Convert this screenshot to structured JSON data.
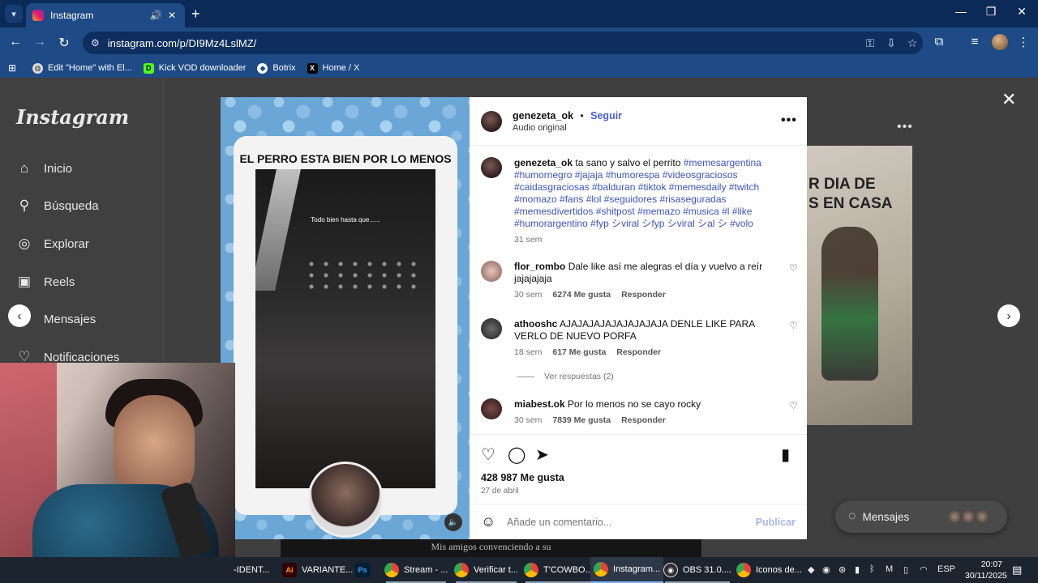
{
  "browser": {
    "tab": {
      "title": "Instagram"
    },
    "url": "instagram.com/p/DI9Mz4LslMZ/",
    "bookmarks": [
      {
        "label": "Edit \"Home\" with El...",
        "icon": "globe-icon"
      },
      {
        "label": "Kick VOD downloader",
        "icon": "kick-icon"
      },
      {
        "label": "Botrix",
        "icon": "botrix-icon"
      },
      {
        "label": "Home / X",
        "icon": "x-icon"
      }
    ]
  },
  "instagram": {
    "logo": "Instagram",
    "nav": [
      {
        "label": "Inicio",
        "icon": "home-icon"
      },
      {
        "label": "Búsqueda",
        "icon": "search-icon"
      },
      {
        "label": "Explorar",
        "icon": "explore-icon"
      },
      {
        "label": "Reels",
        "icon": "reels-icon"
      },
      {
        "label": "Mensajes",
        "icon": "messages-icon"
      },
      {
        "label": "Notificaciones",
        "icon": "heart-icon"
      }
    ],
    "background_post_caption_line1": "R DIA DE",
    "background_post_caption_line2": "S EN CASA",
    "messages_pill": "Mensajes"
  },
  "post": {
    "media": {
      "title": "EL PERRO ESTA BIEN POR LO MENOS",
      "video_caption": "Todo bien hasta que......",
      "subtitle": "Mis amigos convenciendo a su"
    },
    "author": "genezeta_ok",
    "follow_label": "Seguir",
    "separator": "•",
    "audio": "Audio original",
    "caption": {
      "username": "genezeta_ok",
      "text": "ta sano y salvo el perrito",
      "hashtags": "#memesargentina #humornegro #jajaja #humorespa #videosgraciosos #caidasgraciosas #balduran #tiktok #memesdaily #twitch #momazo #fans #lol #seguidores #risaseguradas #memesdivertidos #shitpost #memazo #musica #l #like #humorargentino #fyp シviral シfyp シviral シal シ #volo",
      "time": "31 sem"
    },
    "comments": [
      {
        "username": "flor_rombo",
        "text": "Dale like así me alegras el día y vuelvo a reír jajajajaja",
        "time": "30 sem",
        "likes": "6274 Me gusta",
        "reply": "Responder"
      },
      {
        "username": "athooshc",
        "text": "AJAJAJAJAJAJAJAJAJA DENLE LIKE PARA VERLO DE NUEVO PORFA",
        "time": "18 sem",
        "likes": "617 Me gusta",
        "reply": "Responder",
        "view_replies": "Ver respuestas (2)"
      },
      {
        "username": "miabest.ok",
        "text": "Por lo menos no se cayo rocky",
        "time": "30 sem",
        "likes": "7839 Me gusta",
        "reply": "Responder"
      }
    ],
    "likes": "428 987 Me gusta",
    "date": "27 de abril",
    "add_comment_placeholder": "Añade un comentario...",
    "publish_label": "Publicar"
  },
  "taskbar": {
    "items": [
      {
        "label": "-IDENT...",
        "icon": "app-icon"
      },
      {
        "label": "VARIANTE...",
        "icon": "illustrator-icon"
      },
      {
        "label": "",
        "icon": "photoshop-icon"
      },
      {
        "label": "Stream - ...",
        "icon": "chrome-icon"
      },
      {
        "label": "Verificar t...",
        "icon": "chrome-icon"
      },
      {
        "label": "T'COWBO...",
        "icon": "chrome-icon"
      },
      {
        "label": "Instagram...",
        "icon": "chrome-icon"
      },
      {
        "label": "OBS 31.0....",
        "icon": "obs-icon"
      },
      {
        "label": "Iconos de...",
        "icon": "chrome-icon"
      }
    ],
    "language": "ESP",
    "time": "20:07",
    "date": "30/11/2025"
  }
}
